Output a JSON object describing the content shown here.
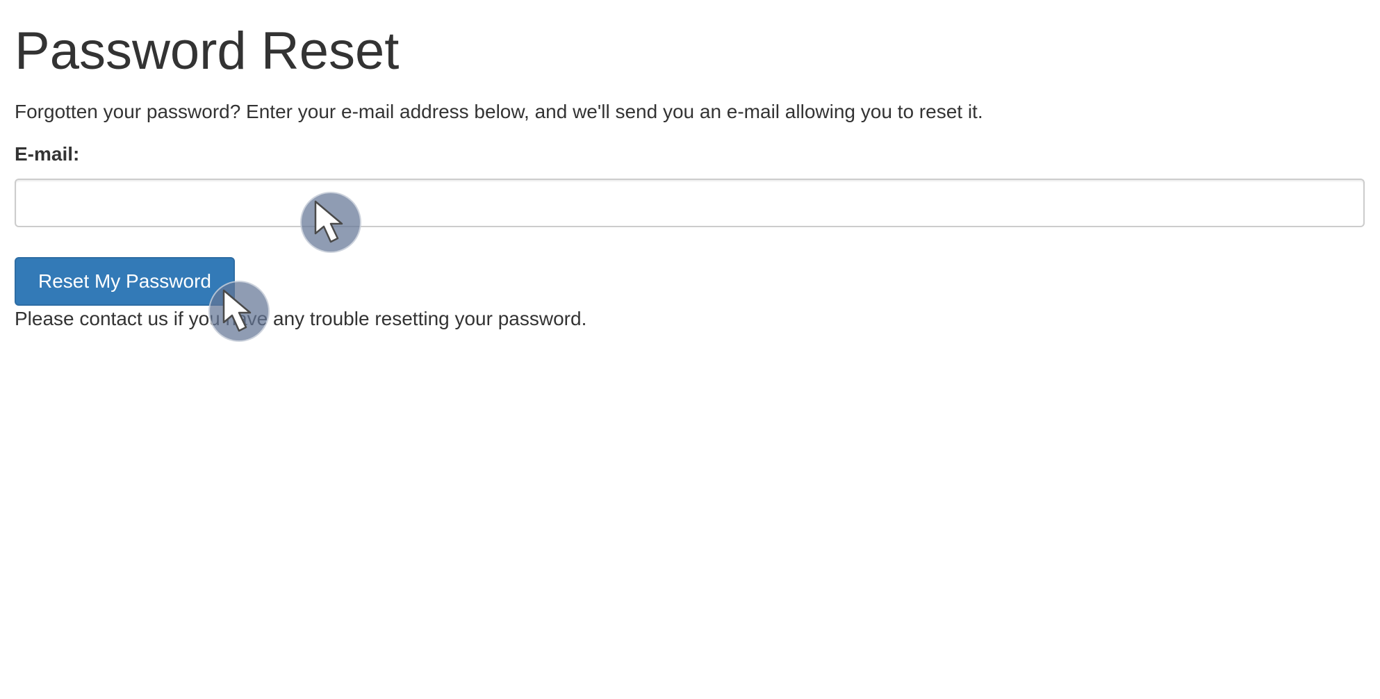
{
  "page": {
    "title": "Password Reset",
    "intro": "Forgotten your password? Enter your e-mail address below, and we'll send you an e-mail allowing you to reset it.",
    "contact_note": "Please contact us if you have any trouble resetting your password."
  },
  "form": {
    "email_label": "E-mail:",
    "email_value": "",
    "email_placeholder": "",
    "submit_label": "Reset My Password"
  },
  "colors": {
    "button_background": "#337ab7",
    "button_border": "#2e6da4",
    "text": "#333333",
    "input_border": "#cccccc"
  },
  "icons": {
    "cursor_overlay": "mouse-pointer-icon"
  }
}
